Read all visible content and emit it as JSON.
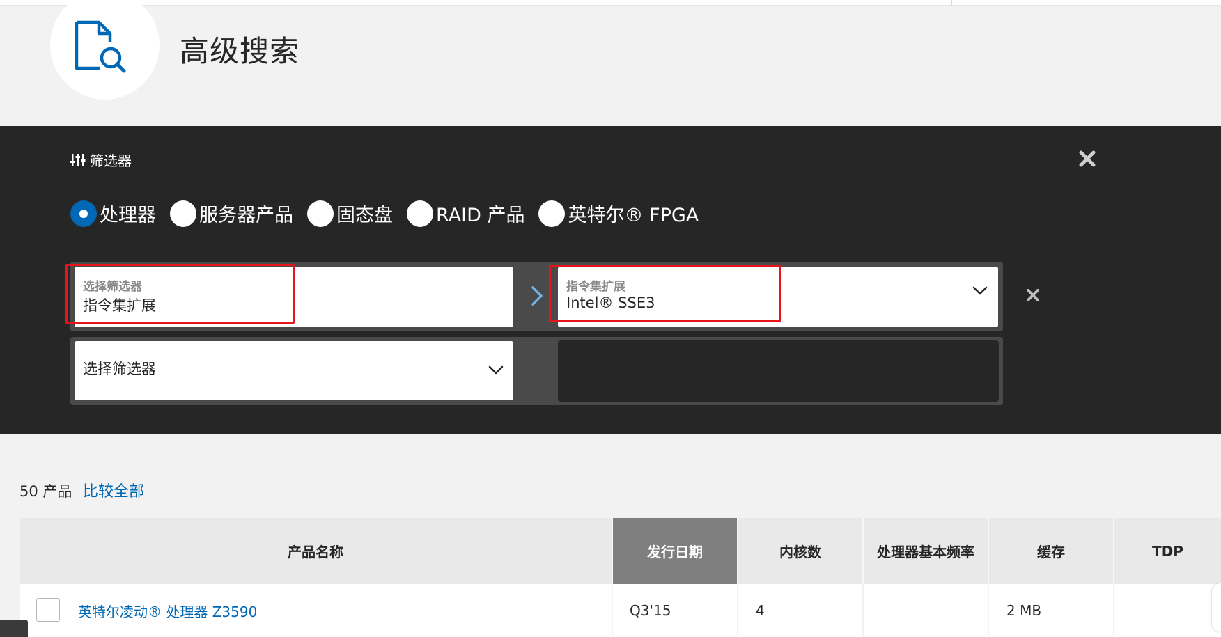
{
  "header": {
    "title": "高级搜索",
    "icon": "document-search-icon"
  },
  "filter_panel": {
    "heading": "筛选器",
    "heading_icon": "sliders-icon",
    "close_icon": "close-icon",
    "product_types": [
      {
        "label": "处理器",
        "selected": true
      },
      {
        "label": "服务器产品",
        "selected": false
      },
      {
        "label": "固态盘",
        "selected": false
      },
      {
        "label": "RAID 产品",
        "selected": false
      },
      {
        "label": "英特尔® FPGA",
        "selected": false
      }
    ],
    "rows": [
      {
        "selector_label": "选择筛选器",
        "selector_value": "指令集扩展",
        "value_label": "指令集扩展",
        "value": "Intel® SSE3"
      },
      {
        "selector_placeholder": "选择筛选器"
      }
    ]
  },
  "results": {
    "count_text": "50 产品",
    "compare_all": "比较全部",
    "columns": [
      "产品名称",
      "发行日期",
      "内核数",
      "处理器基本频率",
      "缓存",
      "TDP"
    ],
    "sorted_column": "发行日期",
    "rows": [
      {
        "name": "英特尔凌动® 处理器 Z3590",
        "release_date": "Q3'15",
        "cores": "4",
        "base_freq": "",
        "cache": "2 MB",
        "tdp": ""
      }
    ]
  },
  "colors": {
    "accent": "#0068b5",
    "panel_bg": "#262626",
    "highlight": "#e8141b"
  }
}
